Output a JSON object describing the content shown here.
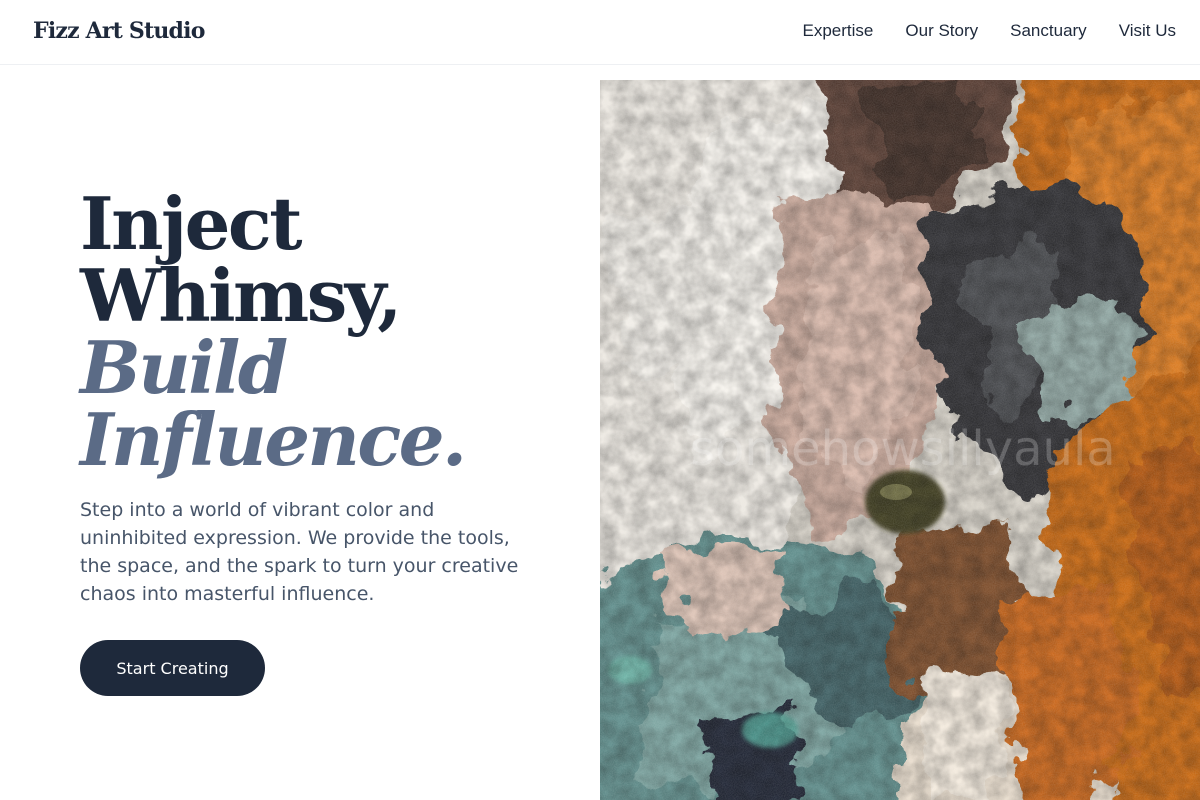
{
  "brand": {
    "name": "Fizz Art Studio"
  },
  "nav": {
    "links": [
      {
        "label": "Expertise"
      },
      {
        "label": "Our Story"
      },
      {
        "label": "Sanctuary"
      },
      {
        "label": "Visit Us"
      }
    ]
  },
  "hero": {
    "headline": {
      "line1": "Inject",
      "line2": "Whimsy,",
      "line3": "Build",
      "line4": "Influence."
    },
    "description": "Step into a world of vibrant color and uninhibited expression. We provide the tools, the space, and the spark to turn your creative chaos into masterful influence.",
    "cta_label": "Start Creating",
    "image_subject": "abstract impasto oil painting texture",
    "image_watermark": "somehowsillyaula"
  },
  "colors": {
    "text_dark": "#1e293b",
    "accent_slate": "#5b6b86",
    "body_text": "#475569",
    "paint_orange": "#c86414",
    "paint_teal": "#5b8b88"
  }
}
